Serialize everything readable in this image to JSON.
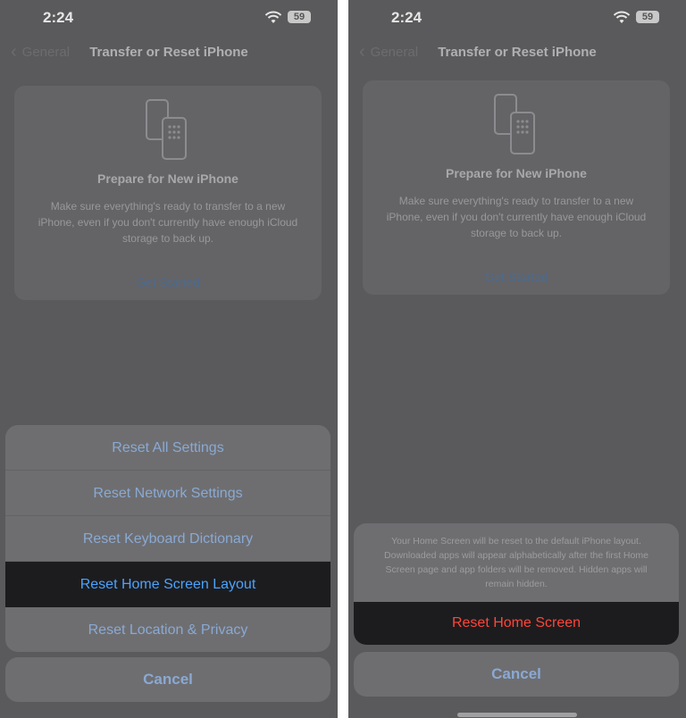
{
  "left": {
    "status": {
      "time": "2:24",
      "battery": "59"
    },
    "nav": {
      "back_label": "General",
      "title": "Transfer or Reset iPhone"
    },
    "card": {
      "title": "Prepare for New iPhone",
      "description": "Make sure everything's ready to transfer to a new iPhone, even if you don't currently have enough iCloud storage to back up.",
      "link": "Get Started"
    },
    "sheet": {
      "items": [
        "Reset All Settings",
        "Reset Network Settings",
        "Reset Keyboard Dictionary",
        "Reset Home Screen Layout",
        "Reset Location & Privacy"
      ],
      "selected_index": 3
    },
    "cancel": "Cancel"
  },
  "right": {
    "status": {
      "time": "2:24",
      "battery": "59"
    },
    "nav": {
      "back_label": "General",
      "title": "Transfer or Reset iPhone"
    },
    "card": {
      "title": "Prepare for New iPhone",
      "description": "Make sure everything's ready to transfer to a new iPhone, even if you don't currently have enough iCloud storage to back up.",
      "link": "Get Started"
    },
    "alert": {
      "message": "Your Home Screen will be reset to the default iPhone layout. Downloaded apps will appear alphabetically after the first Home Screen page and app folders will be removed. Hidden apps will remain hidden.",
      "confirm": "Reset Home Screen"
    },
    "cancel": "Cancel"
  },
  "colors": {
    "accent": "#4aa3ff",
    "destructive": "#ff453a",
    "dimmed_bg": "#5a5a5c"
  }
}
